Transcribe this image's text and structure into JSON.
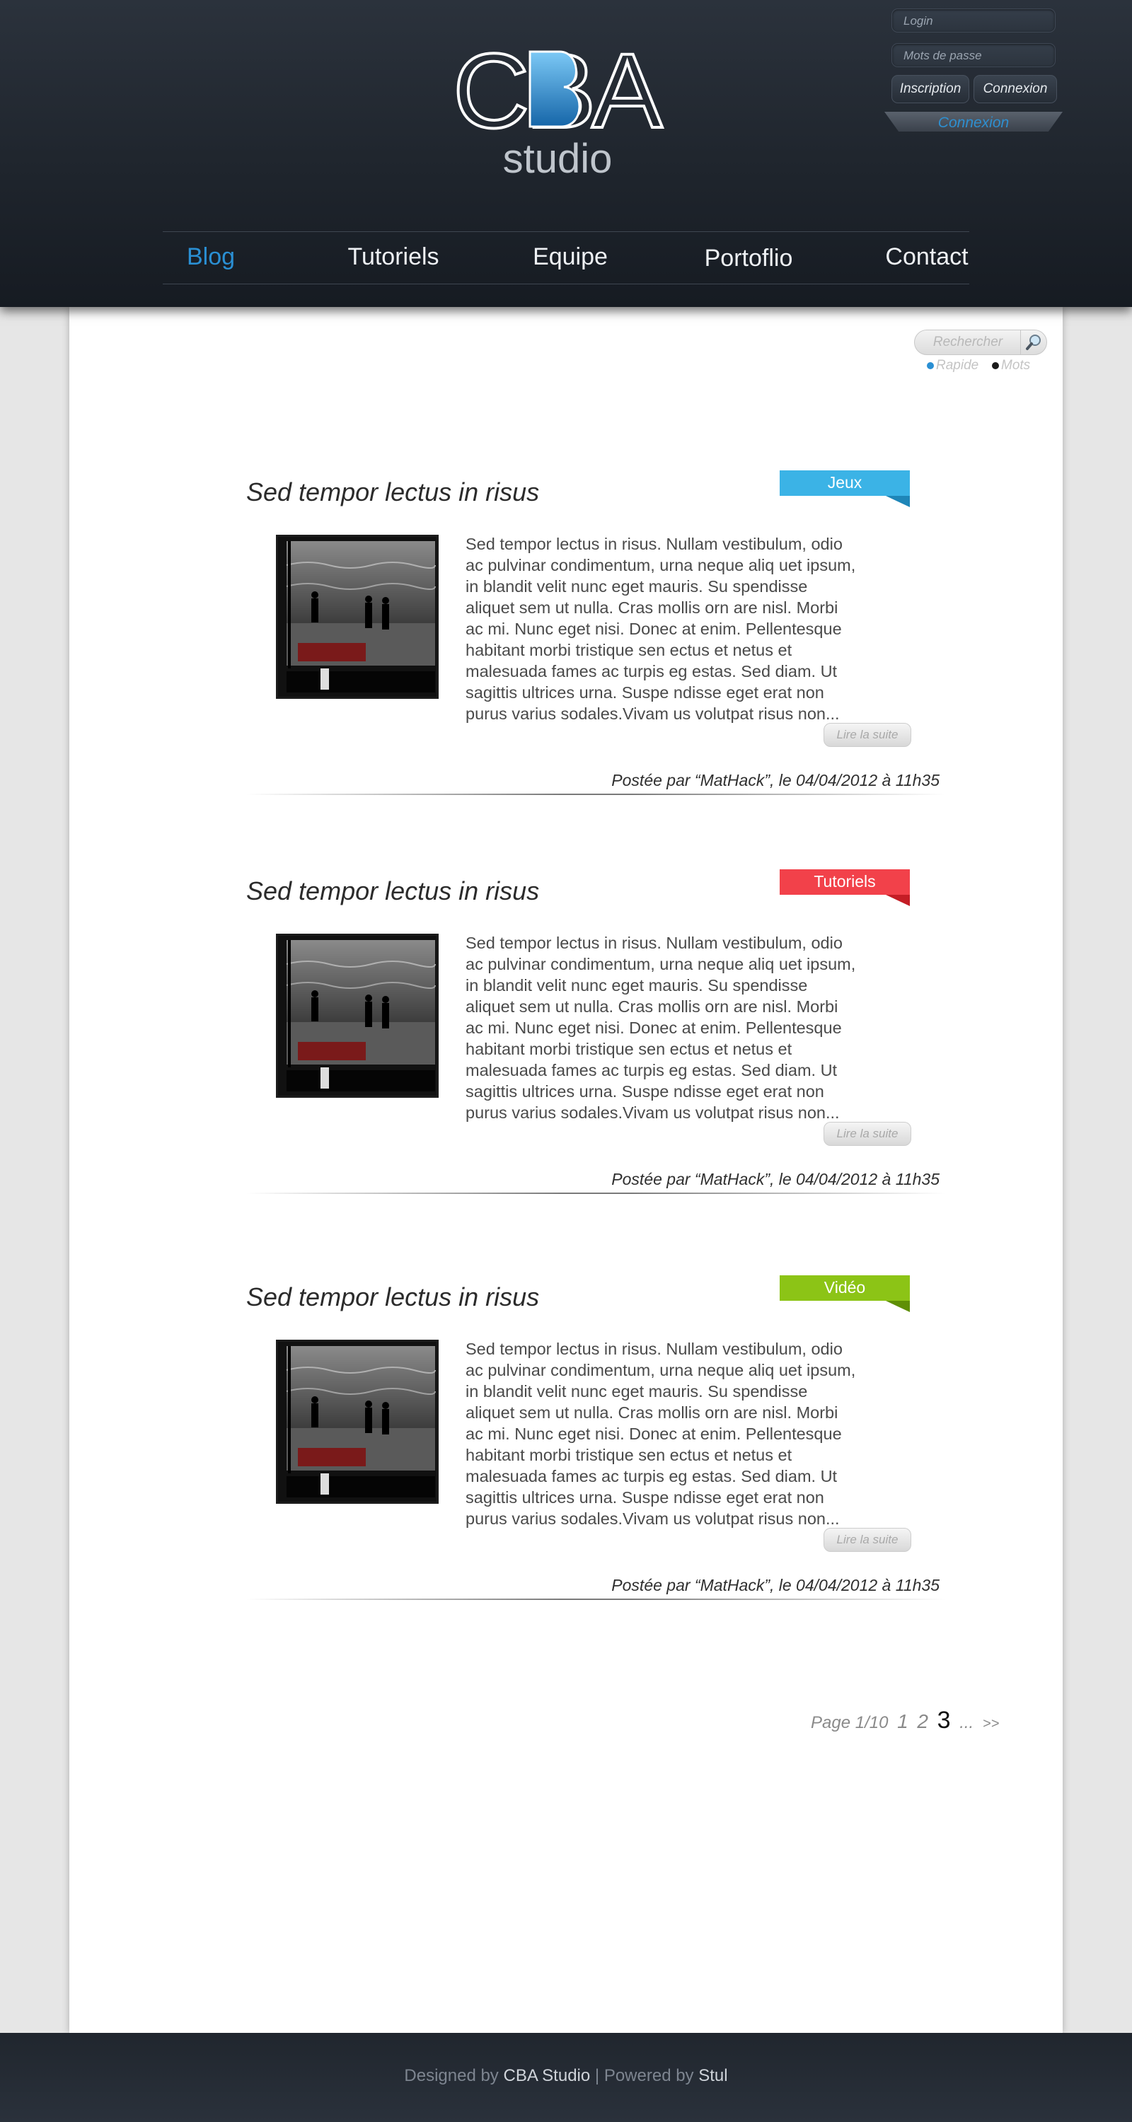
{
  "header": {
    "logo": {
      "letters": "CBA",
      "sub": "studio"
    },
    "login": {
      "login_placeholder": "Login",
      "password_placeholder": "Mots de passe",
      "register_label": "Inscription",
      "connect_label": "Connexion",
      "tab_label": "Connexion"
    },
    "nav": [
      {
        "label": "Blog",
        "active": true
      },
      {
        "label": "Tutoriels",
        "active": false
      },
      {
        "label": "Equipe",
        "active": false
      },
      {
        "label": "Portoflio",
        "active": false
      },
      {
        "label": "Contact",
        "active": false
      }
    ],
    "accent_color": "#2a8fd3"
  },
  "search": {
    "placeholder": "Rechercher",
    "options": [
      {
        "label": "Rapide",
        "selected": true
      },
      {
        "label": "Mots",
        "selected": false
      }
    ]
  },
  "posts": [
    {
      "title": "Sed tempor lectus in risus",
      "tag": {
        "label": "Jeux",
        "color": "#3bb3e6",
        "fold_color": "#1e86b8"
      },
      "excerpt": "Sed tempor lectus in risus. Nullam vestibulum, odio ac pulvinar condimentum, urna neque aliq uet ipsum, in blandit velit nunc eget mauris. Su spendisse aliquet sem ut nulla. Cras mollis orn are nisl. Morbi ac mi. Nunc eget nisi. Donec at enim. Pellentesque habitant morbi tristique sen ectus et netus et malesuada fames ac turpis eg estas. Sed diam. Ut sagittis ultrices urna. Suspe ndisse eget erat non purus varius sodales.Vivam us volutpat risus non...",
      "read_more": "Lire la suite",
      "meta": "Postée par “MatHack”, le 04/04/2012 à 11h35"
    },
    {
      "title": "Sed tempor lectus in risus",
      "tag": {
        "label": "Tutoriels",
        "color": "#f2414a",
        "fold_color": "#c41d25"
      },
      "excerpt": "Sed tempor lectus in risus. Nullam vestibulum, odio ac pulvinar condimentum, urna neque aliq uet ipsum, in blandit velit nunc eget mauris. Su spendisse aliquet sem ut nulla. Cras mollis orn are nisl. Morbi ac mi. Nunc eget nisi. Donec at enim. Pellentesque habitant morbi tristique sen ectus et netus et malesuada fames ac turpis eg estas. Sed diam. Ut sagittis ultrices urna. Suspe ndisse eget erat non purus varius sodales.Vivam us volutpat risus non...",
      "read_more": "Lire la suite",
      "meta": "Postée par “MatHack”, le 04/04/2012 à 11h35"
    },
    {
      "title": "Sed tempor lectus in risus",
      "tag": {
        "label": "Vidéo",
        "color": "#8cc416",
        "fold_color": "#5f8f06"
      },
      "excerpt": "Sed tempor lectus in risus. Nullam vestibulum, odio ac pulvinar condimentum, urna neque aliq uet ipsum, in blandit velit nunc eget mauris. Su spendisse aliquet sem ut nulla. Cras mollis orn are nisl. Morbi ac mi. Nunc eget nisi. Donec at enim. Pellentesque habitant morbi tristique sen ectus et netus et malesuada fames ac turpis eg estas. Sed diam. Ut sagittis ultrices urna. Suspe ndisse eget erat non purus varius sodales.Vivam us volutpat risus non...",
      "read_more": "Lire la suite",
      "meta": "Postée par “MatHack”, le 04/04/2012 à 11h35"
    }
  ],
  "pagination": {
    "label": "Page 1/10",
    "pages": [
      "1",
      "2",
      "3"
    ],
    "current": "3",
    "more": "...",
    "next": ">>"
  },
  "footer": {
    "designed_by": "Designed by",
    "studio": "CBA Studio",
    "separator": "|",
    "powered_by": "Powered by",
    "engine": "Stul"
  }
}
